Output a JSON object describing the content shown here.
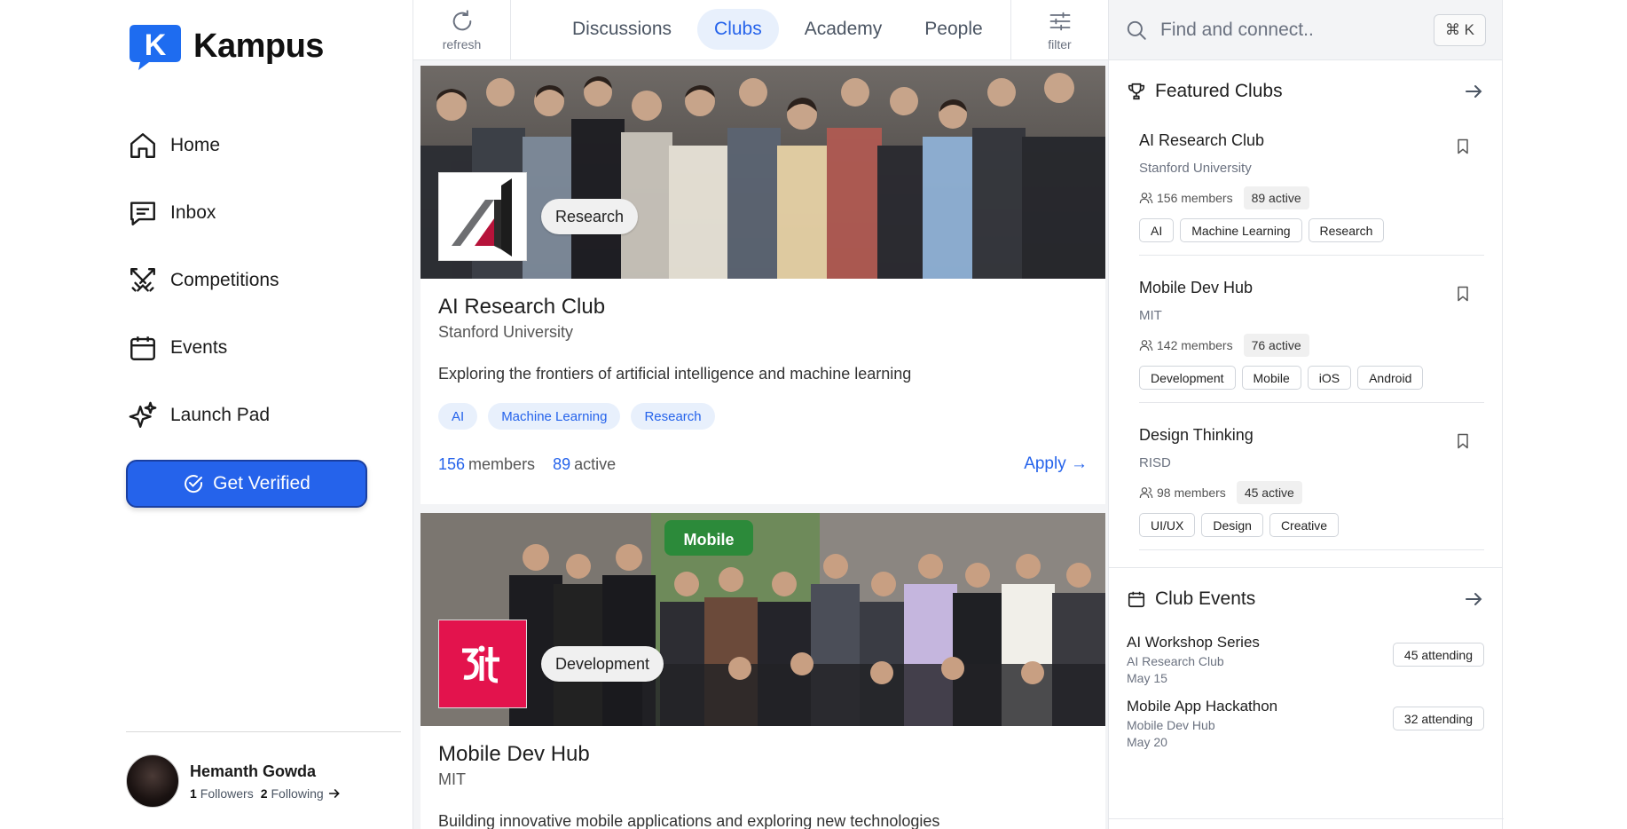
{
  "brand": {
    "name": "Kampus",
    "logo_letter": "K",
    "accent": "#2563eb"
  },
  "nav": {
    "items": [
      {
        "label": "Home",
        "icon": "home-icon"
      },
      {
        "label": "Inbox",
        "icon": "inbox-icon"
      },
      {
        "label": "Competitions",
        "icon": "swords-icon"
      },
      {
        "label": "Events",
        "icon": "calendar-icon"
      },
      {
        "label": "Launch Pad",
        "icon": "sparkles-icon"
      }
    ],
    "verify_label": "Get Verified"
  },
  "profile": {
    "name": "Hemanth Gowda",
    "followers_count": "1",
    "followers_label": "Followers",
    "following_count": "2",
    "following_label": "Following"
  },
  "topbar": {
    "refresh_label": "refresh",
    "filter_label": "filter",
    "tabs": [
      {
        "label": "Discussions",
        "active": false
      },
      {
        "label": "Clubs",
        "active": true
      },
      {
        "label": "Academy",
        "active": false
      },
      {
        "label": "People",
        "active": false
      }
    ]
  },
  "feed": {
    "clubs": [
      {
        "category": "Research",
        "name": "AI Research Club",
        "university": "Stanford University",
        "description": "Exploring the frontiers of artificial intelligence and machine learning",
        "tags": [
          "AI",
          "Machine Learning",
          "Research"
        ],
        "members_count": "156",
        "members_label": "members",
        "active_count": "89",
        "active_label": "active",
        "apply_label": "Apply →"
      },
      {
        "category": "Development",
        "name": "Mobile Dev Hub",
        "university": "MIT",
        "description": "Building innovative mobile applications and exploring new technologies",
        "photo_sign": "Mobile"
      }
    ]
  },
  "search": {
    "placeholder": "Find and connect..",
    "shortcut": "⌘ K"
  },
  "featured": {
    "title": "Featured Clubs",
    "clubs": [
      {
        "name": "AI Research Club",
        "university": "Stanford University",
        "members": "156 members",
        "active": "89 active",
        "tags": [
          "AI",
          "Machine Learning",
          "Research"
        ]
      },
      {
        "name": "Mobile Dev Hub",
        "university": "MIT",
        "members": "142 members",
        "active": "76 active",
        "tags": [
          "Development",
          "Mobile",
          "iOS",
          "Android"
        ]
      },
      {
        "name": "Design Thinking",
        "university": "RISD",
        "members": "98 members",
        "active": "45 active",
        "tags": [
          "UI/UX",
          "Design",
          "Creative"
        ]
      }
    ]
  },
  "events": {
    "title": "Club Events",
    "items": [
      {
        "name": "AI Workshop Series",
        "club": "AI Research Club",
        "date": "May 15",
        "attending": "45 attending"
      },
      {
        "name": "Mobile App Hackathon",
        "club": "Mobile Dev Hub",
        "date": "May 20",
        "attending": "32 attending"
      }
    ]
  }
}
